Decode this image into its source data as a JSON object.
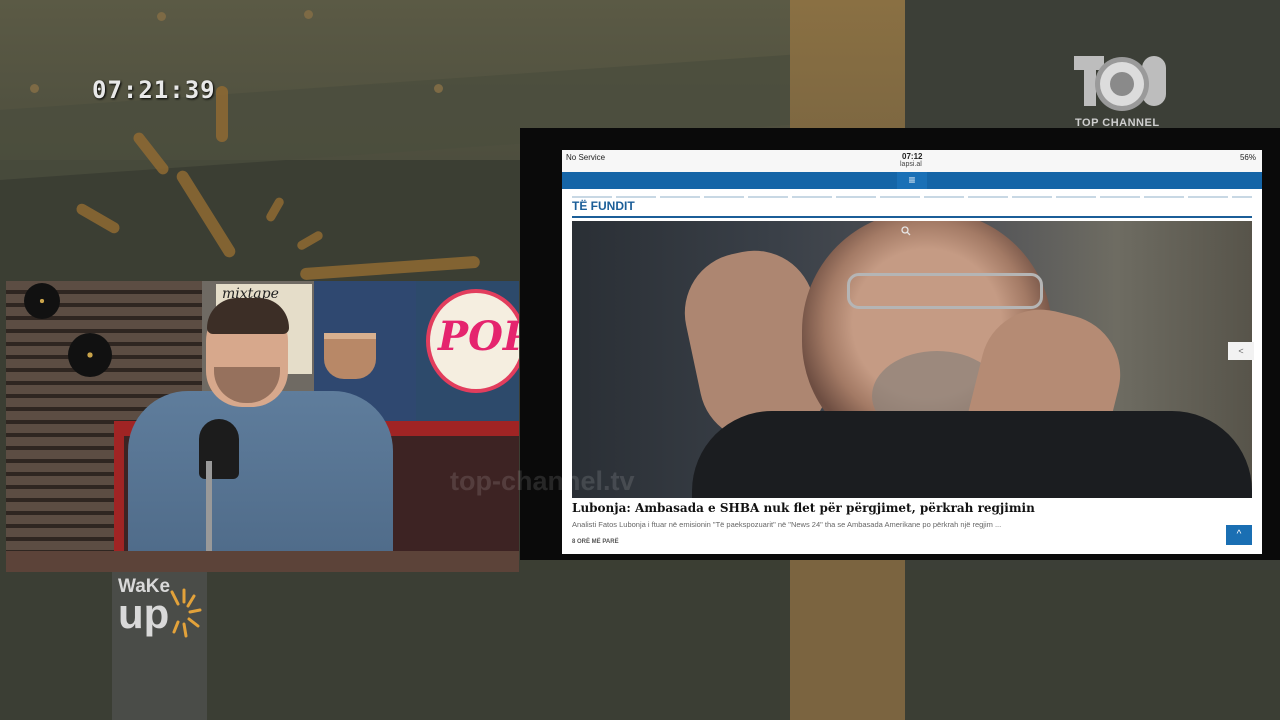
{
  "overlay": {
    "clock": "07:21:39",
    "channel_logo_text": "TOP CHANNEL",
    "watermark": "top-channel.tv",
    "show_logo": {
      "wake": "WaKe",
      "up": "up"
    }
  },
  "camera": {
    "poster_mixtape": "mixtape",
    "poster_pop": "POP"
  },
  "phone": {
    "status": {
      "carrier": "No Service",
      "time": "07:12",
      "url": "lapsi.al",
      "battery": "56%"
    },
    "menu_icon": "≡",
    "section_title": "TË FUNDIT",
    "article": {
      "headline": "Lubonja: Ambasada e SHBA nuk flet për përgjimet, përkrah regjimin",
      "excerpt": "Analisti Fatos Lubonja i ftuar në emisionin \"Të paekspozuarit\" në \"News 24\" tha se Ambasada Amerikane po përkrah një regjim ...",
      "time_ago": "8 ORË MË PARË"
    },
    "share_icon": "<",
    "back_to_top_icon": "^"
  },
  "colors": {
    "nav_blue": "#1565a7",
    "accent_orange": "#8f6a33"
  }
}
